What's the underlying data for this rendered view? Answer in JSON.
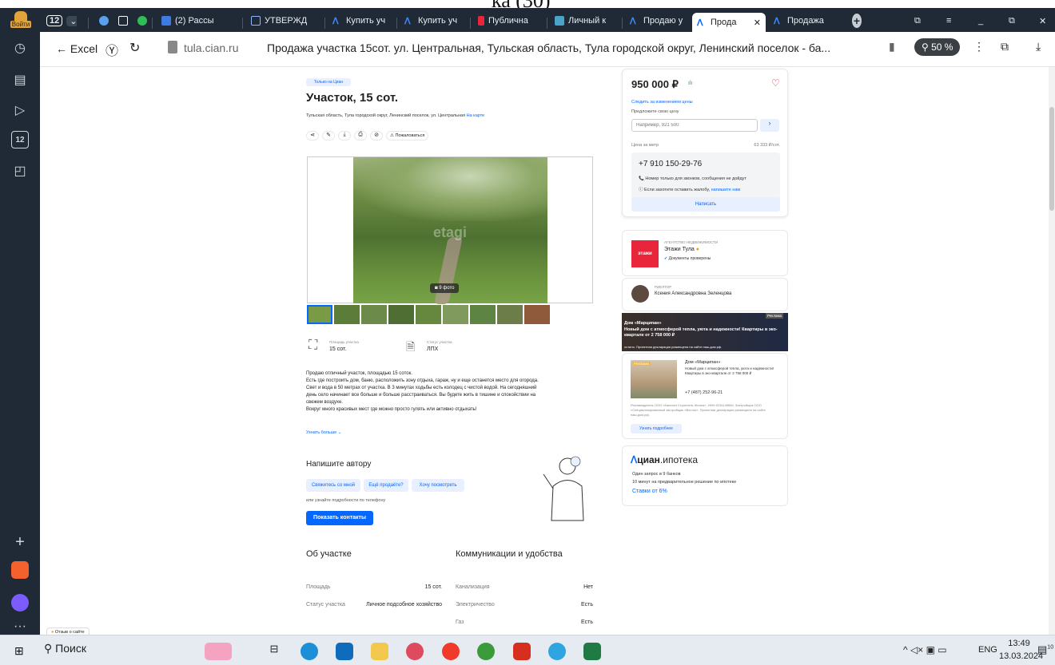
{
  "window": {
    "caption": "ка     (30)"
  },
  "tabs": [
    {
      "label": "",
      "icon": "profile-login-icon",
      "sub": "Войти"
    },
    {
      "label": "12",
      "icon": "tab-counter-icon"
    },
    {
      "label": "(2) Рассы",
      "icon": "mail-icon"
    },
    {
      "label": "УТВЕРЖД",
      "icon": "document-icon"
    },
    {
      "label": "Купить уч",
      "icon": "cian-icon"
    },
    {
      "label": "Купить уч",
      "icon": "cian-icon"
    },
    {
      "label": "Публична",
      "icon": "map-icon"
    },
    {
      "label": "Личный к",
      "icon": "cabinet-icon"
    },
    {
      "label": "Продаю у",
      "icon": "cian-icon"
    },
    {
      "label": "Прода",
      "icon": "cian-icon"
    },
    {
      "label": "Продажа",
      "icon": "cian-icon"
    }
  ],
  "address": {
    "back_label": "← Excel",
    "domain": "tula.cian.ru",
    "title": "Продажа участка 15сот. ул. Центральная, Тульская область, Тула городской округ, Ленинский поселок - ба...",
    "zoom": "50 %"
  },
  "listing": {
    "badge": "Только на Циан",
    "title": "Участок, 15 сот.",
    "address": "Тульская область, Тула городской округ, Ленинский поселок, ул. Центральная",
    "map_link": "На карте",
    "complain": "Пожаловаться",
    "photo_count": "9 фото",
    "watermark": "etagi",
    "area_label": "Площадь участка",
    "area_value": "15 сот.",
    "status_label": "Статус участка",
    "status_value": "ЛПХ",
    "description": [
      "Продаю отличный участок, площадью 15 соток.",
      "Есть где построить дом, баню, расположить зону отдыха, гараж, ну и еще останется место для огорода.",
      "Свет и вода в 50 метрах от участка. В 3 минутах ходьбы есть колодец с чистой водой. На сегодняшний",
      "день село начинает все больше и больше расстраиваться. Вы будете жить в тишине и спокойствии на",
      "свежем воздухе.",
      "Вокруг много красивых мест где можно просто гулять или активно отдыхать!"
    ],
    "more": "Узнать больше",
    "write_title": "Напишите автору",
    "chips": [
      "Свяжитесь со мной",
      "Ещё продаёте?",
      "Хочу посмотреть"
    ],
    "phone_hint": "или узнайте подробности по телефону",
    "show_contacts": "Показать контакты",
    "about_title": "Об участке",
    "comm_title": "Коммуникации и удобства",
    "about_rows": [
      {
        "k": "Площадь",
        "v": "15 сот."
      },
      {
        "k": "Статус участка",
        "v": "Личное подсобное хозяйство"
      }
    ],
    "comm_rows": [
      {
        "k": "Канализация",
        "v": "Нет"
      },
      {
        "k": "Электричество",
        "v": "Есть"
      },
      {
        "k": "Газ",
        "v": "Есть"
      }
    ],
    "feedback": "Отзыв о сайте"
  },
  "price_card": {
    "price": "950 000 ₽",
    "follow": "Следить за изменением цены",
    "offer_label": "Предложите свою цену",
    "offer_placeholder": "Например, 921 500",
    "per_meter_label": "Цена за метр",
    "per_meter_value": "63 333 ₽/сот.",
    "phone": "+7 910 150-29-76",
    "note1": "Номер только для звонков, сообщения не дойдут",
    "note2": "Если захотите оставить жалобу,",
    "note2_link": "напишите нам",
    "write": "Написать"
  },
  "agency": {
    "kind": "агентство недвижимости",
    "name": "Этажи Тула",
    "verified": "Документы проверены",
    "logo": "этажи"
  },
  "realtor": {
    "kind": "риелтор",
    "name": "Ксения Александровна Зеленцова"
  },
  "ad1": {
    "tag": "Реклама",
    "title": "Дом «Марципан»",
    "text": "Новый дом с атмосферой тепла, уюта и надежности! Квартиры в эко-квартале от 2 758 000 ₽",
    "foot": "остило. Проектная декларация размещена на сайте наш.дом.рф."
  },
  "ad2": {
    "tag": "РЕКЛАМА",
    "title": "Дом «Марципан»",
    "text": "Новый дом с атмосферой тепла, уюта и надежности! Квартиры в эко-квартале от 2 758 000 ₽",
    "phone": "+7 (487) 252-96-21",
    "legal": "Рекламодатель ООО «Капитал Строитель Жилья», ИНН 6234145684. Застройщик ООО «Специализированный застройщик «Восток». Проектная декларация размещена на сайте наш.дом.рф.",
    "more": "Узнать подробнее"
  },
  "mortgage": {
    "brand_a": "циан",
    "brand_b": ".ипотека",
    "l1": "Один запрос в 9 банков",
    "l2": "10 минут на предварительное решение по ипотеке",
    "rate": "Ставки от 6%"
  },
  "taskbar": {
    "search": "Поиск",
    "lang": "ENG",
    "time": "13:49",
    "date": "13.03.2024",
    "notif": "10"
  }
}
